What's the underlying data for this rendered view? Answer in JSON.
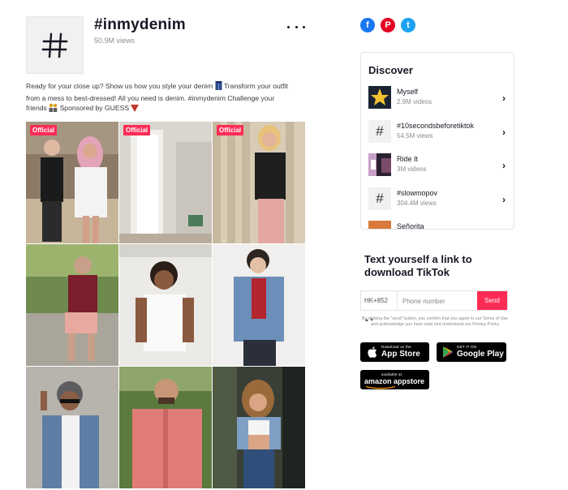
{
  "hashtag": {
    "title": "#inmydenim",
    "views": "50.9M views",
    "more_icon": "more-dots-icon",
    "description": {
      "part1": "Ready for your close up? Show us how you style your denim ",
      "part2": " Transform your outfit from a mess to best-dressed! All you need is denim. #inmydenim Challenge your friends ",
      "part3": " Sponsored by GUESS ",
      "emoji1": "blue-jeans-emoji",
      "emoji2": "people-emoji",
      "emoji3": "red-triangle-emoji"
    }
  },
  "videos": [
    {
      "badge": "Official"
    },
    {
      "badge": "Official"
    },
    {
      "badge": "Official"
    },
    {
      "badge": ""
    },
    {
      "badge": ""
    },
    {
      "badge": ""
    },
    {
      "badge": ""
    },
    {
      "badge": ""
    },
    {
      "badge": ""
    }
  ],
  "share": {
    "facebook": "f",
    "pinterest": "P",
    "twitter": "t"
  },
  "discover": {
    "title": "Discover",
    "items": [
      {
        "name": "Myself",
        "count": "2.9M videos",
        "thumb": "image"
      },
      {
        "name": "#10secondsbeforetiktok",
        "count": "54.5M views",
        "thumb": "hashtag"
      },
      {
        "name": "Ride It",
        "count": "3M videos",
        "thumb": "image"
      },
      {
        "name": "#slowmopov",
        "count": "304.4M views",
        "thumb": "hashtag"
      },
      {
        "name": "Señorita",
        "count": "",
        "thumb": "image"
      }
    ]
  },
  "download": {
    "title": "Text yourself a link to download TikTok",
    "country_code": "HK+852",
    "phone_placeholder": "Phone number",
    "send_label": "Send",
    "legal": "By clicking the \"send\" button, you confirm that you agree to our Terms of Use and acknowledge you have read and understood our Privacy Policy",
    "app_store": {
      "small": "Download on the",
      "big": "App Store"
    },
    "google_play": {
      "small": "GET IT ON",
      "big": "Google Play"
    },
    "amazon": {
      "small": "available at",
      "big": "amazon appstore"
    }
  },
  "colors": {
    "accent": "#fe2c55",
    "facebook": "#1877f2",
    "pinterest": "#e60023",
    "twitter": "#1da1f2"
  }
}
